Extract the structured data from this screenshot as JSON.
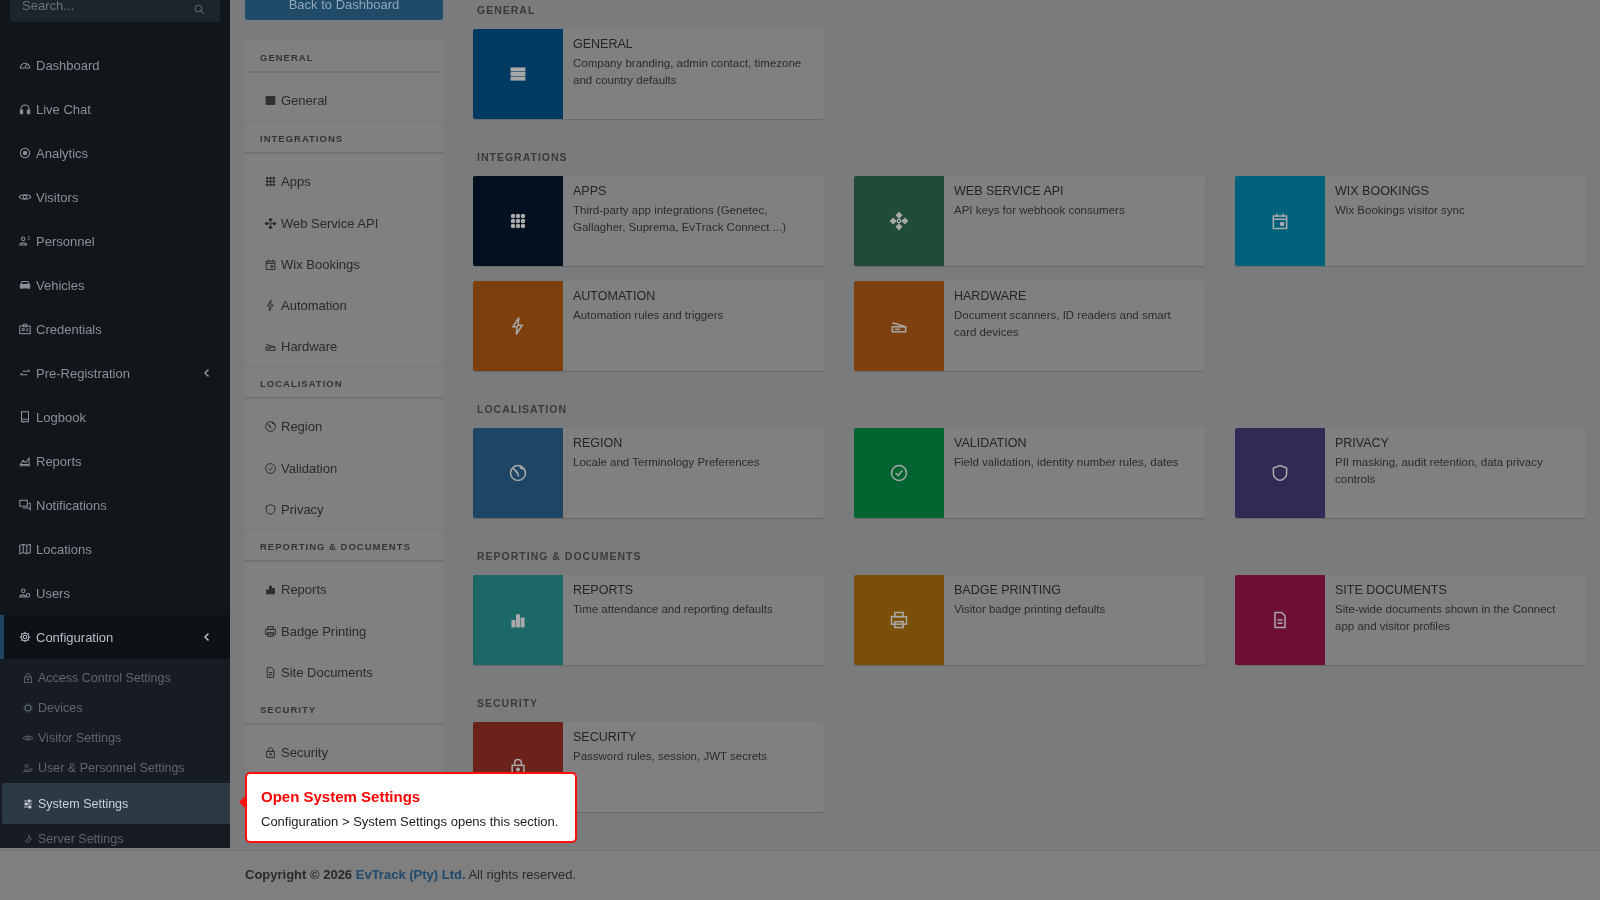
{
  "sidebar": {
    "search": {
      "placeholder": "Search..."
    },
    "items": [
      {
        "label": "Dashboard",
        "kind": "link",
        "selected": false
      },
      {
        "label": "Live Chat",
        "kind": "link",
        "selected": false
      },
      {
        "label": "Analytics",
        "kind": "link",
        "selected": false
      },
      {
        "label": "Visitors",
        "kind": "link",
        "selected": false
      },
      {
        "label": "Personnel",
        "kind": "link",
        "selected": false
      },
      {
        "label": "Vehicles",
        "kind": "link",
        "selected": false
      },
      {
        "label": "Credentials",
        "kind": "link",
        "selected": false
      },
      {
        "label": "Pre-Registration",
        "kind": "group",
        "selected": false
      },
      {
        "label": "Logbook",
        "kind": "link",
        "selected": false
      },
      {
        "label": "Reports",
        "kind": "link",
        "selected": false
      },
      {
        "label": "Notifications",
        "kind": "link",
        "selected": false
      },
      {
        "label": "Locations",
        "kind": "link",
        "selected": false
      },
      {
        "label": "Users",
        "kind": "link",
        "selected": false
      },
      {
        "label": "Configuration",
        "kind": "group",
        "selected": true,
        "children": [
          {
            "label": "Access Control Settings",
            "selected": false
          },
          {
            "label": "Devices",
            "selected": false
          },
          {
            "label": "Visitor Settings",
            "selected": false
          },
          {
            "label": "User & Personnel Settings",
            "selected": false
          },
          {
            "label": "System Settings",
            "selected": true
          },
          {
            "label": "Server Settings",
            "selected": false
          }
        ]
      }
    ]
  },
  "back_button": "Back to Dashboard",
  "settings_nav": [
    {
      "heading": "GENERAL",
      "items": [
        "General"
      ]
    },
    {
      "heading": "INTEGRATIONS",
      "items": [
        "Apps",
        "Web Service API",
        "Wix Bookings",
        "Automation",
        "Hardware"
      ]
    },
    {
      "heading": "LOCALISATION",
      "items": [
        "Region",
        "Validation",
        "Privacy"
      ]
    },
    {
      "heading": "REPORTING & DOCUMENTS",
      "items": [
        "Reports",
        "Badge Printing",
        "Site Documents"
      ]
    },
    {
      "heading": "SECURITY",
      "items": [
        "Security"
      ]
    }
  ],
  "sections": [
    {
      "heading": "GENERAL",
      "cards": [
        {
          "title": "GENERAL",
          "description": "Company branding, admin contact, timezone and country defaults",
          "color": "#003a60"
        }
      ]
    },
    {
      "heading": "INTEGRATIONS",
      "cards": [
        {
          "title": "APPS",
          "description": "Third-party app integrations (Genetec, Gallagher, Suprema, EvTrack Connect ...)",
          "color": "#02101f"
        },
        {
          "title": "WEB SERVICE API",
          "description": "API keys for webhook consumers",
          "color": "#1f4b37"
        },
        {
          "title": "WIX BOOKINGS",
          "description": "Wix Bookings visitor sync",
          "color": "#00627a"
        },
        {
          "title": "AUTOMATION",
          "description": "Automation rules and triggers",
          "color": "#7d400d"
        },
        {
          "title": "HARDWARE",
          "description": "Document scanners, ID readers and smart card devices",
          "color": "#7d400e"
        }
      ]
    },
    {
      "heading": "LOCALISATION",
      "cards": [
        {
          "title": "REGION",
          "description": "Locale and Terminology Preferences",
          "color": "#1e4664"
        },
        {
          "title": "VALIDATION",
          "description": "Field validation, identity number rules, dates",
          "color": "#006430"
        },
        {
          "title": "PRIVACY",
          "description": "PII masking, audit retention, data privacy controls",
          "color": "#302b56"
        }
      ]
    },
    {
      "heading": "REPORTING & DOCUMENTS",
      "cards": [
        {
          "title": "REPORTS",
          "description": "Time attendance and reporting defaults",
          "color": "#1b6867"
        },
        {
          "title": "BADGE PRINTING",
          "description": "Visitor badge printing defaults",
          "color": "#7a5008"
        },
        {
          "title": "SITE DOCUMENTS",
          "description": "Site-wide documents shown in the Connect app and visitor profiles",
          "color": "#6e0f35"
        }
      ]
    },
    {
      "heading": "SECURITY",
      "cards": [
        {
          "title": "SECURITY",
          "description": "Password rules, session, JWT secrets",
          "color": "#6b221b"
        }
      ]
    }
  ],
  "tour_tooltip": {
    "title": "Open System Settings",
    "text": "Configuration > System Settings opens this section."
  },
  "footer": {
    "prefix": "**Copyright © 2026**",
    "link": "EvTrack (Pty) Ltd.",
    "suffix": "All rights reserved."
  }
}
